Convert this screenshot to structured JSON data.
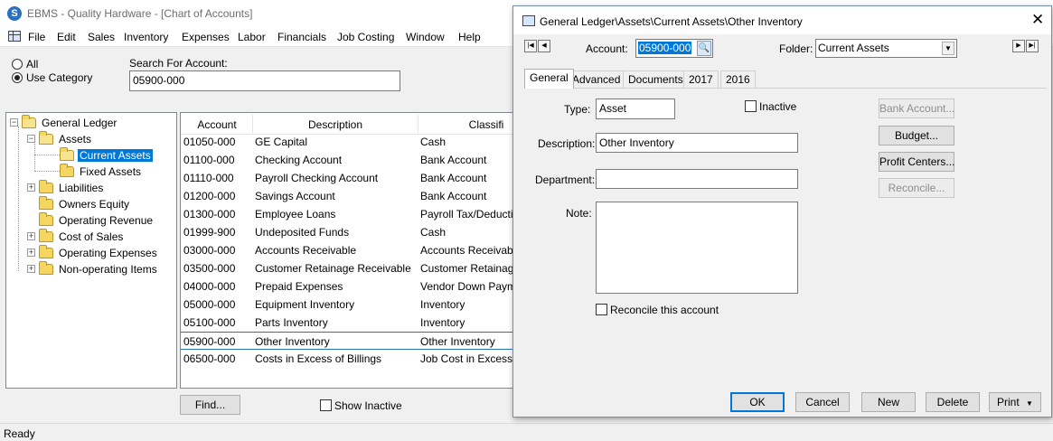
{
  "main_window": {
    "title": "EBMS - Quality Hardware - [Chart of Accounts]",
    "logo_letter": "S",
    "menu": [
      "File",
      "Edit",
      "Sales",
      "Inventory",
      "Expenses",
      "Labor",
      "Financials",
      "Job Costing",
      "Window",
      "Help"
    ],
    "filter": {
      "radio_all": "All",
      "radio_use_category": "Use Category",
      "search_label": "Search For Account:",
      "search_value": "05900-000"
    },
    "tree": {
      "root": "General Ledger",
      "items": [
        "Assets",
        "Current Assets",
        "Fixed Assets",
        "Liabilities",
        "Owners Equity",
        "Operating Revenue",
        "Cost of Sales",
        "Operating Expenses",
        "Non-operating Items"
      ]
    },
    "grid": {
      "columns": [
        "Account",
        "Description",
        "Classifi"
      ],
      "rows": [
        [
          "01050-000",
          "GE Capital",
          "Cash"
        ],
        [
          "01100-000",
          "Checking Account",
          "Bank Account"
        ],
        [
          "01110-000",
          "Payroll Checking Account",
          "Bank Account"
        ],
        [
          "01200-000",
          "Savings Account",
          "Bank Account"
        ],
        [
          "01300-000",
          "Employee Loans",
          "Payroll Tax/Deduction"
        ],
        [
          "01999-900",
          "Undeposited Funds",
          "Cash"
        ],
        [
          "03000-000",
          "Accounts Receivable",
          "Accounts Receivable"
        ],
        [
          "03500-000",
          "Customer Retainage Receivable",
          "Customer Retainage"
        ],
        [
          "04000-000",
          "Prepaid Expenses",
          "Vendor Down Paymen"
        ],
        [
          "05000-000",
          "Equipment Inventory",
          "Inventory"
        ],
        [
          "05100-000",
          "Parts Inventory",
          "Inventory"
        ],
        [
          "05900-000",
          "Other Inventory",
          "Other Inventory"
        ],
        [
          "06500-000",
          "Costs in Excess of Billings",
          "Job Cost in Excess"
        ]
      ]
    },
    "find_button": "Find...",
    "show_inactive": "Show Inactive",
    "status": "Ready"
  },
  "dialog": {
    "title": "General Ledger\\Assets\\Current Assets\\Other Inventory",
    "close_glyph": "✕",
    "account_label": "Account:",
    "account_value": "05900-000",
    "folder_label": "Folder:",
    "folder_value": "Current Assets",
    "tabs": [
      "General",
      "Advanced",
      "Documents",
      "2017",
      "2016"
    ],
    "type_label": "Type:",
    "type_value": "Asset",
    "inactive_label": "Inactive",
    "description_label": "Description:",
    "description_value": "Other Inventory",
    "department_label": "Department:",
    "department_value": "",
    "note_label": "Note:",
    "note_value": "",
    "reconcile_label": "Reconcile this account",
    "side_buttons": {
      "bank_account": "Bank Account...",
      "budget": "Budget...",
      "profit_centers": "Profit Centers...",
      "reconcile": "Reconcile..."
    },
    "footer_buttons": {
      "ok": "OK",
      "cancel": "Cancel",
      "new": "New",
      "delete": "Delete",
      "print": "Print"
    }
  }
}
